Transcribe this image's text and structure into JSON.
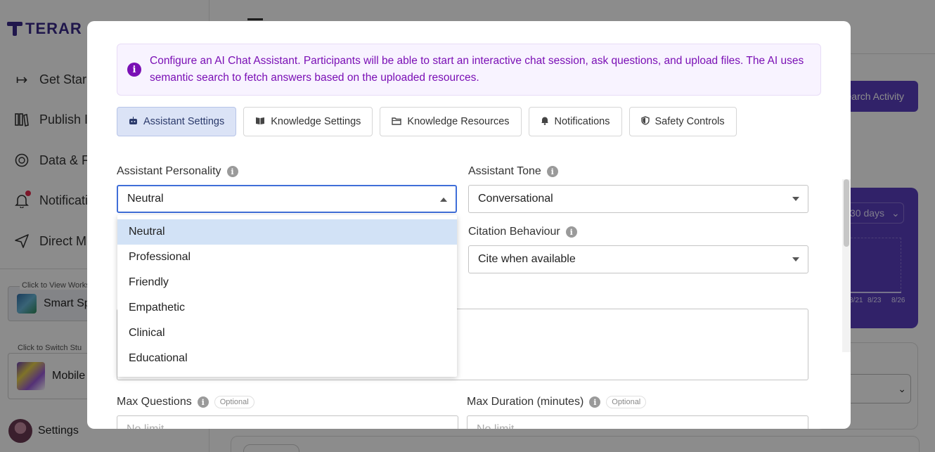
{
  "background": {
    "logo_text": "TERAR",
    "nav": [
      {
        "icon": "arrow-right-bar-icon",
        "label": "Get Star"
      },
      {
        "icon": "books-icon",
        "label": "Publish I"
      },
      {
        "icon": "globe-icon",
        "label": "Data & F"
      },
      {
        "icon": "bell-icon",
        "label": "Notificati"
      },
      {
        "icon": "send-icon",
        "label": "Direct M"
      }
    ],
    "workspace_caption": "Click to View Works",
    "workspace_name": "Smart Sp",
    "study_caption": "Click to Switch Stu",
    "study_name": "Mobile",
    "settings_label": "Settings",
    "activity_button": "earch Activity",
    "chart_range": "30 days",
    "chart_ticks": [
      "8/21",
      "8/23",
      "8/26"
    ]
  },
  "modal": {
    "info_icon": "i",
    "info_text": "Configure an AI Chat Assistant. Participants will be able to start an interactive chat session, ask questions, and upload files. The AI uses semantic search to fetch answers based on the uploaded resources.",
    "tabs": [
      {
        "icon": "robot-icon",
        "glyph": "🤖",
        "label": "Assistant Settings",
        "active": true
      },
      {
        "icon": "book-icon",
        "glyph": "📖",
        "label": "Knowledge Settings",
        "active": false
      },
      {
        "icon": "folder-icon",
        "glyph": "📂",
        "label": "Knowledge Resources",
        "active": false
      },
      {
        "icon": "bell-icon",
        "glyph": "🔔",
        "label": "Notifications",
        "active": false
      },
      {
        "icon": "shield-icon",
        "glyph": "🛡",
        "label": "Safety Controls",
        "active": false
      }
    ],
    "personality": {
      "label": "Assistant Personality",
      "value": "Neutral",
      "options": [
        "Neutral",
        "Professional",
        "Friendly",
        "Empathetic",
        "Clinical",
        "Educational"
      ],
      "selected": "Neutral"
    },
    "tone": {
      "label": "Assistant Tone",
      "value": "Conversational"
    },
    "citation": {
      "label": "Citation Behaviour",
      "value": "Cite when available"
    },
    "max_questions": {
      "label": "Max Questions",
      "badge": "Optional",
      "placeholder": "No limit"
    },
    "max_duration": {
      "label": "Max Duration (minutes)",
      "badge": "Optional",
      "placeholder": "No limit"
    },
    "help_glyph": "i"
  },
  "colors": {
    "accent_purple": "#5a3fc0",
    "info_text": "#7a0fb5",
    "active_tab_bg": "#dbe3f6",
    "selected_option_bg": "#d2e2f6",
    "focus_border": "#3f6ed8"
  }
}
